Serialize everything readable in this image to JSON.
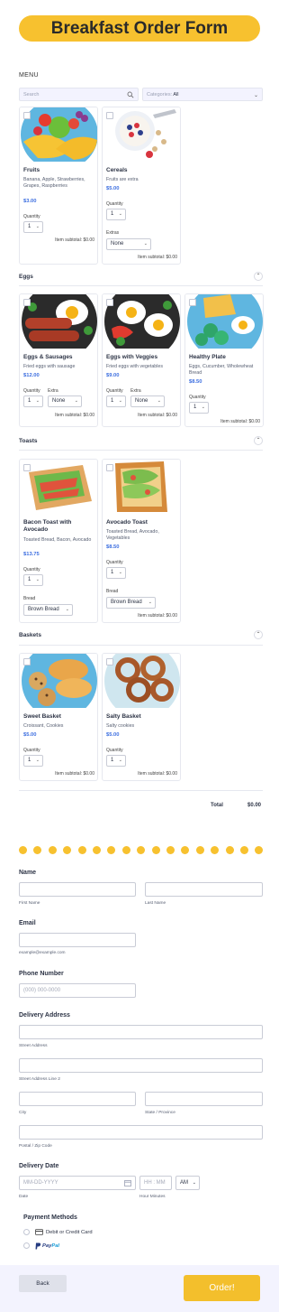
{
  "form": {
    "title": "Breakfast Order Form"
  },
  "menu": {
    "label": "MENU",
    "search_placeholder": "Search",
    "categories_label": "Categories:",
    "categories_value": "All"
  },
  "common": {
    "quantity_label": "Quantity",
    "subtotal_label": "Item subtotal:",
    "subtotal_value": "$0.00",
    "qty_value": "1",
    "extras_label": "Extras",
    "extra_label": "Extra",
    "none": "None",
    "bread_label": "Bread",
    "brown_bread": "Brown Bread"
  },
  "products": {
    "fruits": {
      "name": "Fruits",
      "desc": "Banana, Apple, Strawberries, Grapes, Raspberries",
      "price": "$3.00"
    },
    "cereals": {
      "name": "Cereals",
      "desc": "Fruits are extra",
      "price": "$5.00"
    },
    "eggs_sausages": {
      "name": "Eggs & Sausages",
      "desc": "Fried eggs with sausage",
      "price": "$12.00"
    },
    "eggs_veggies": {
      "name": "Eggs with Veggies",
      "desc": "Fried eggs with vegetables",
      "price": "$9.00"
    },
    "healthy_plate": {
      "name": "Healthy Plate",
      "desc": "Eggs, Cucumber, Wholewheat Bread",
      "price": "$8.50"
    },
    "bacon_toast": {
      "name": "Bacon Toast with Avocado",
      "desc": "Toasted Bread, Bacon, Avocado",
      "price": "$13.75"
    },
    "avocado_toast": {
      "name": "Avocado Toast",
      "desc": "Toasted Bread, Avocado, Vegetables",
      "price": "$8.50"
    },
    "sweet_basket": {
      "name": "Sweet Basket",
      "desc": "Croissant, Cookies",
      "price": "$5.00"
    },
    "salty_basket": {
      "name": "Salty Basket",
      "desc": "Salty cookies",
      "price": "$5.00"
    }
  },
  "sections": {
    "eggs": "Eggs",
    "toasts": "Toasts",
    "baskets": "Baskets"
  },
  "total": {
    "label": "Total",
    "value": "$0.00"
  },
  "fields": {
    "name_label": "Name",
    "first_name": "First Name",
    "last_name": "Last Name",
    "email_label": "Email",
    "email_sub": "example@example.com",
    "phone_label": "Phone Number",
    "phone_placeholder": "(000) 000-0000",
    "address_label": "Delivery Address",
    "street": "Street Address",
    "street2": "Street Address Line 2",
    "city": "City",
    "state": "State / Province",
    "postal": "Postal / Zip Code",
    "date_label": "Delivery Date",
    "date_placeholder": "MM-DD-YYYY",
    "date_sub": "Date",
    "time_placeholder": "HH : MM",
    "time_sub": "Hour Minutes",
    "ampm": "AM",
    "payment_label": "Payment Methods",
    "pay_card": "Debit or Credit Card",
    "pay_paypal_1": "Pay",
    "pay_paypal_2": "Pal"
  },
  "buttons": {
    "back": "Back",
    "order": "Order!"
  },
  "colors": {
    "accent": "#f7c12f",
    "price": "#3c6ee0",
    "button": "#f3bf2c"
  }
}
